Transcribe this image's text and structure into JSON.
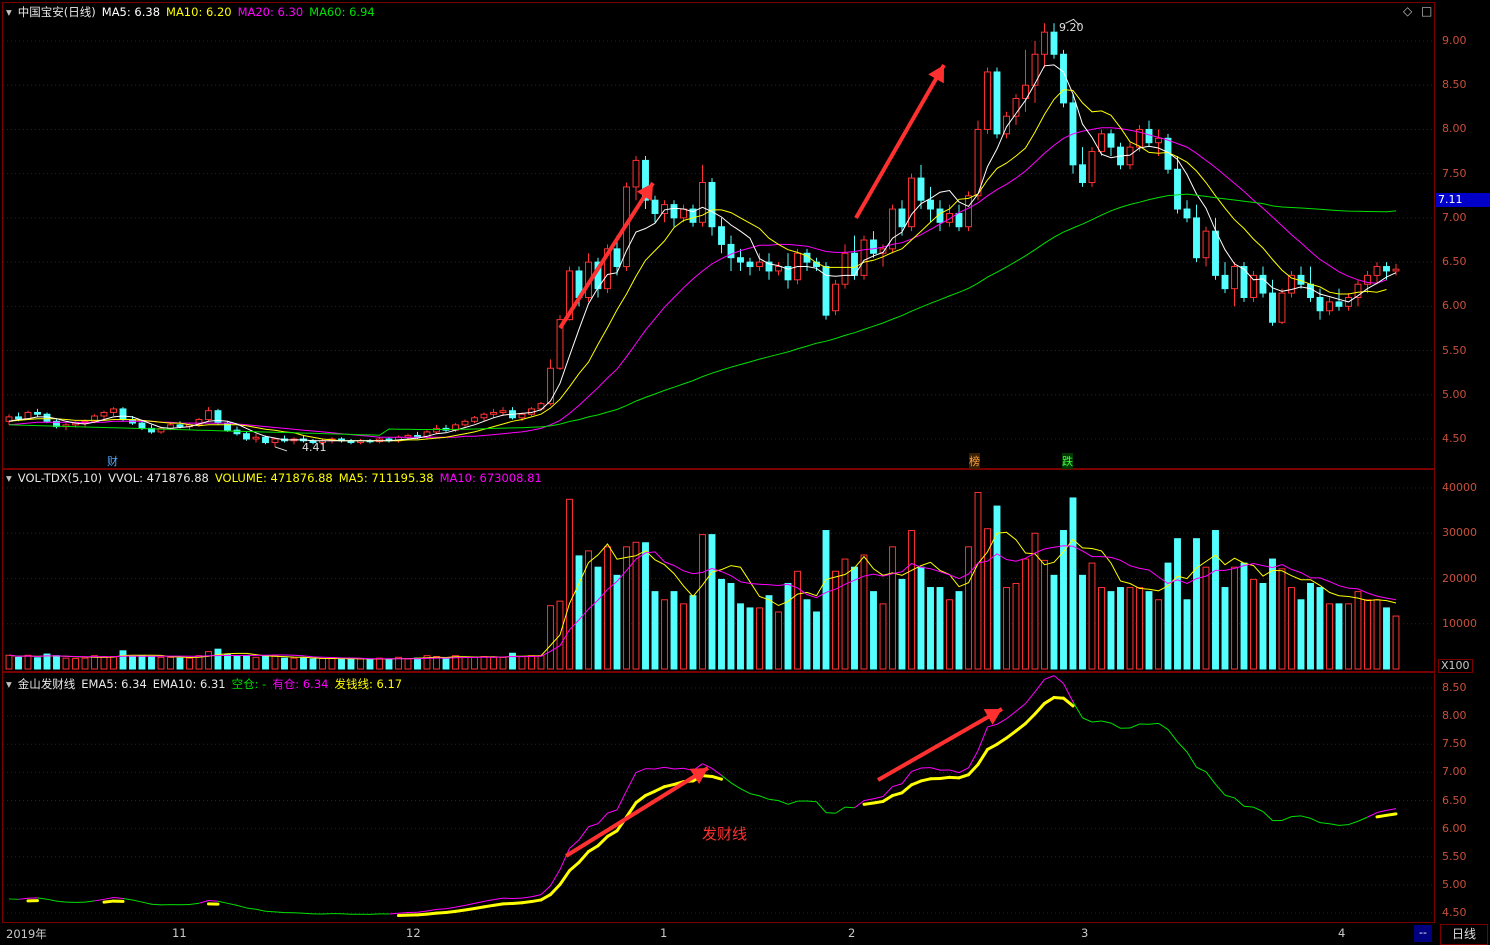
{
  "main_panel": {
    "stock_name": "中国宝安(日线)",
    "ma5": "MA5: 6.38",
    "ma10": "MA10: 6.20",
    "ma20": "MA20: 6.30",
    "ma60": "MA60: 6.94",
    "high_marker": "9.20",
    "low_marker": "4.41",
    "current_price_tag": "7.11",
    "event_tags": [
      "财",
      "榜",
      "跌"
    ],
    "y_ticks": [
      "9.00",
      "8.50",
      "8.00",
      "7.50",
      "7.00",
      "6.50",
      "6.00",
      "5.50",
      "5.00",
      "4.50"
    ]
  },
  "vol_panel": {
    "name": "VOL-TDX(5,10)",
    "vvol": "VVOL: 471876.88",
    "volume": "VOLUME: 471876.88",
    "ma5": "MA5: 711195.38",
    "ma10": "MA10: 673008.81",
    "y_ticks": [
      "40000",
      "30000",
      "20000",
      "10000"
    ],
    "unit": "X100"
  },
  "ind_panel": {
    "name": "金山发财线",
    "ema5": "EMA5: 6.34",
    "ema10": "EMA10: 6.31",
    "kongcang": "空仓: -",
    "youcang": "有仓: 6.34",
    "faqian": "发钱线: 6.17",
    "annotation": "发财线",
    "y_ticks": [
      "8.50",
      "8.00",
      "7.50",
      "7.00",
      "6.50",
      "6.00",
      "5.50",
      "5.00",
      "4.50"
    ]
  },
  "date_axis": [
    "2019年",
    "11",
    "12",
    "1",
    "2",
    "3",
    "4"
  ],
  "period_button": "日线",
  "colors": {
    "up": "#ff3232",
    "down": "#54ffff",
    "ma5": "#ffffff",
    "ma10": "#ffff00",
    "ma20": "#ff00ff",
    "ma60": "#00e000",
    "grid": "#7a0000",
    "axis_text": "#c8503c"
  },
  "chart_data": {
    "type": "candlestick",
    "title": "中国宝安(日线)",
    "price_range": [
      4.4,
      9.3
    ],
    "candles": [
      [
        4.7,
        4.78,
        4.66,
        4.75
      ],
      [
        4.75,
        4.8,
        4.7,
        4.73
      ],
      [
        4.73,
        4.82,
        4.72,
        4.8
      ],
      [
        4.8,
        4.84,
        4.75,
        4.78
      ],
      [
        4.78,
        4.8,
        4.68,
        4.7
      ],
      [
        4.7,
        4.72,
        4.62,
        4.64
      ],
      [
        4.64,
        4.68,
        4.6,
        4.66
      ],
      [
        4.66,
        4.7,
        4.63,
        4.68
      ],
      [
        4.68,
        4.72,
        4.64,
        4.7
      ],
      [
        4.7,
        4.78,
        4.68,
        4.76
      ],
      [
        4.76,
        4.82,
        4.72,
        4.8
      ],
      [
        4.8,
        4.86,
        4.76,
        4.84
      ],
      [
        4.84,
        4.86,
        4.7,
        4.72
      ],
      [
        4.72,
        4.76,
        4.66,
        4.68
      ],
      [
        4.68,
        4.7,
        4.6,
        4.62
      ],
      [
        4.62,
        4.66,
        4.56,
        4.58
      ],
      [
        4.58,
        4.64,
        4.56,
        4.62
      ],
      [
        4.62,
        4.68,
        4.6,
        4.66
      ],
      [
        4.66,
        4.7,
        4.62,
        4.64
      ],
      [
        4.64,
        4.68,
        4.6,
        4.66
      ],
      [
        4.66,
        4.74,
        4.64,
        4.72
      ],
      [
        4.72,
        4.86,
        4.7,
        4.82
      ],
      [
        4.82,
        4.84,
        4.66,
        4.68
      ],
      [
        4.68,
        4.7,
        4.58,
        4.6
      ],
      [
        4.6,
        4.64,
        4.54,
        4.56
      ],
      [
        4.56,
        4.58,
        4.48,
        4.5
      ],
      [
        4.5,
        4.56,
        4.46,
        4.52
      ],
      [
        4.52,
        4.54,
        4.44,
        4.46
      ],
      [
        4.46,
        4.52,
        4.41,
        4.5
      ],
      [
        4.5,
        4.54,
        4.46,
        4.48
      ],
      [
        4.48,
        4.52,
        4.44,
        4.5
      ],
      [
        4.5,
        4.54,
        4.46,
        4.48
      ],
      [
        4.48,
        4.5,
        4.44,
        4.46
      ],
      [
        4.46,
        4.5,
        4.43,
        4.48
      ],
      [
        4.48,
        4.52,
        4.45,
        4.5
      ],
      [
        4.5,
        4.52,
        4.46,
        4.48
      ],
      [
        4.48,
        4.5,
        4.44,
        4.46
      ],
      [
        4.46,
        4.5,
        4.44,
        4.48
      ],
      [
        4.48,
        4.5,
        4.45,
        4.47
      ],
      [
        4.47,
        4.52,
        4.45,
        4.5
      ],
      [
        4.5,
        4.52,
        4.46,
        4.48
      ],
      [
        4.48,
        4.54,
        4.46,
        4.52
      ],
      [
        4.52,
        4.56,
        4.5,
        4.54
      ],
      [
        4.54,
        4.58,
        4.5,
        4.52
      ],
      [
        4.52,
        4.6,
        4.5,
        4.58
      ],
      [
        4.58,
        4.66,
        4.56,
        4.62
      ],
      [
        4.62,
        4.66,
        4.58,
        4.6
      ],
      [
        4.6,
        4.68,
        4.58,
        4.66
      ],
      [
        4.66,
        4.72,
        4.64,
        4.7
      ],
      [
        4.7,
        4.76,
        4.68,
        4.74
      ],
      [
        4.74,
        4.8,
        4.7,
        4.78
      ],
      [
        4.78,
        4.84,
        4.74,
        4.8
      ],
      [
        4.8,
        4.86,
        4.76,
        4.82
      ],
      [
        4.82,
        4.86,
        4.72,
        4.74
      ],
      [
        4.74,
        4.8,
        4.7,
        4.78
      ],
      [
        4.78,
        4.86,
        4.76,
        4.84
      ],
      [
        4.84,
        4.92,
        4.82,
        4.9
      ],
      [
        4.9,
        5.4,
        4.88,
        5.3
      ],
      [
        5.3,
        5.9,
        5.28,
        5.85
      ],
      [
        5.85,
        6.45,
        5.84,
        6.4
      ],
      [
        6.4,
        6.45,
        6.0,
        6.1
      ],
      [
        6.1,
        6.6,
        6.05,
        6.5
      ],
      [
        6.5,
        6.55,
        6.1,
        6.2
      ],
      [
        6.2,
        6.7,
        6.15,
        6.65
      ],
      [
        6.65,
        6.8,
        6.35,
        6.45
      ],
      [
        6.45,
        7.4,
        6.4,
        7.35
      ],
      [
        7.35,
        7.7,
        7.2,
        7.65
      ],
      [
        7.65,
        7.7,
        7.1,
        7.2
      ],
      [
        7.2,
        7.25,
        6.95,
        7.05
      ],
      [
        7.05,
        7.2,
        6.95,
        7.15
      ],
      [
        7.15,
        7.2,
        6.9,
        7.0
      ],
      [
        7.0,
        7.15,
        6.95,
        7.1
      ],
      [
        7.1,
        7.15,
        6.9,
        6.95
      ],
      [
        6.95,
        7.6,
        6.9,
        7.4
      ],
      [
        7.4,
        7.45,
        6.8,
        6.9
      ],
      [
        6.9,
        7.0,
        6.6,
        6.7
      ],
      [
        6.7,
        6.8,
        6.4,
        6.55
      ],
      [
        6.55,
        6.65,
        6.4,
        6.5
      ],
      [
        6.5,
        6.55,
        6.35,
        6.45
      ],
      [
        6.45,
        6.6,
        6.4,
        6.5
      ],
      [
        6.5,
        6.6,
        6.3,
        6.4
      ],
      [
        6.4,
        6.5,
        6.35,
        6.45
      ],
      [
        6.45,
        6.6,
        6.2,
        6.3
      ],
      [
        6.3,
        6.65,
        6.25,
        6.6
      ],
      [
        6.6,
        6.65,
        6.4,
        6.5
      ],
      [
        6.5,
        6.55,
        6.4,
        6.45
      ],
      [
        6.45,
        6.5,
        5.85,
        5.9
      ],
      [
        5.95,
        6.3,
        5.9,
        6.25
      ],
      [
        6.25,
        6.7,
        6.2,
        6.6
      ],
      [
        6.6,
        6.8,
        6.3,
        6.35
      ],
      [
        6.35,
        6.8,
        6.3,
        6.75
      ],
      [
        6.75,
        6.85,
        6.55,
        6.6
      ],
      [
        6.6,
        6.7,
        6.45,
        6.65
      ],
      [
        6.65,
        7.15,
        6.6,
        7.1
      ],
      [
        7.1,
        7.2,
        6.8,
        6.9
      ],
      [
        6.9,
        7.5,
        6.85,
        7.45
      ],
      [
        7.45,
        7.6,
        7.1,
        7.2
      ],
      [
        7.2,
        7.35,
        6.95,
        7.1
      ],
      [
        7.1,
        7.2,
        6.85,
        6.95
      ],
      [
        6.95,
        7.15,
        6.9,
        7.05
      ],
      [
        7.05,
        7.15,
        6.85,
        6.9
      ],
      [
        6.9,
        7.3,
        6.85,
        7.25
      ],
      [
        7.25,
        8.1,
        7.2,
        8.0
      ],
      [
        8.0,
        8.7,
        7.95,
        8.65
      ],
      [
        8.65,
        8.7,
        7.9,
        7.95
      ],
      [
        7.95,
        8.2,
        7.9,
        8.15
      ],
      [
        8.15,
        8.4,
        8.05,
        8.35
      ],
      [
        8.35,
        8.9,
        8.2,
        8.5
      ],
      [
        8.5,
        9.0,
        8.3,
        8.85
      ],
      [
        8.85,
        9.2,
        8.7,
        9.1
      ],
      [
        9.1,
        9.2,
        8.8,
        8.85
      ],
      [
        8.85,
        8.9,
        8.25,
        8.3
      ],
      [
        8.3,
        8.4,
        7.5,
        7.6
      ],
      [
        7.6,
        7.8,
        7.35,
        7.4
      ],
      [
        7.4,
        7.8,
        7.35,
        7.75
      ],
      [
        7.75,
        8.0,
        7.7,
        7.95
      ],
      [
        7.95,
        8.0,
        7.7,
        7.8
      ],
      [
        7.8,
        7.85,
        7.55,
        7.6
      ],
      [
        7.6,
        7.85,
        7.55,
        7.8
      ],
      [
        7.8,
        8.05,
        7.75,
        8.0
      ],
      [
        8.0,
        8.1,
        7.8,
        7.85
      ],
      [
        7.85,
        8.0,
        7.7,
        7.9
      ],
      [
        7.9,
        7.95,
        7.5,
        7.55
      ],
      [
        7.55,
        7.7,
        7.05,
        7.1
      ],
      [
        7.1,
        7.2,
        6.95,
        7.0
      ],
      [
        7.0,
        7.15,
        6.5,
        6.55
      ],
      [
        6.55,
        6.9,
        6.45,
        6.85
      ],
      [
        6.85,
        7.0,
        6.3,
        6.35
      ],
      [
        6.35,
        6.5,
        6.15,
        6.2
      ],
      [
        6.2,
        6.5,
        6.0,
        6.45
      ],
      [
        6.45,
        6.5,
        6.05,
        6.1
      ],
      [
        6.1,
        6.4,
        6.05,
        6.35
      ],
      [
        6.35,
        6.45,
        6.1,
        6.15
      ],
      [
        6.15,
        6.3,
        5.78,
        5.82
      ],
      [
        5.82,
        6.2,
        5.8,
        6.15
      ],
      [
        6.15,
        6.4,
        6.1,
        6.35
      ],
      [
        6.35,
        6.45,
        6.2,
        6.25
      ],
      [
        6.25,
        6.45,
        6.05,
        6.1
      ],
      [
        6.1,
        6.2,
        5.85,
        5.95
      ],
      [
        5.95,
        6.1,
        5.9,
        6.05
      ],
      [
        6.05,
        6.2,
        5.95,
        6.0
      ],
      [
        6.0,
        6.15,
        5.95,
        6.1
      ],
      [
        6.1,
        6.3,
        6.0,
        6.25
      ],
      [
        6.25,
        6.4,
        6.15,
        6.35
      ],
      [
        6.35,
        6.5,
        6.25,
        6.45
      ],
      [
        6.45,
        6.5,
        6.3,
        6.4
      ],
      [
        6.4,
        6.48,
        6.35,
        6.42
      ]
    ],
    "ma5_series": [
      4.7,
      4.72,
      4.73,
      4.75,
      4.75,
      4.73,
      4.7,
      4.68,
      4.67,
      4.69,
      4.72,
      4.75,
      4.76,
      4.75,
      4.71,
      4.67,
      4.63,
      4.62,
      4.63,
      4.64,
      4.67,
      4.7,
      4.71,
      4.7,
      4.67,
      4.62,
      4.57,
      4.53,
      4.51,
      4.49,
      4.49,
      4.49,
      4.48,
      4.48,
      4.48,
      4.48,
      4.48,
      4.48,
      4.48,
      4.48,
      4.48,
      4.49,
      4.5,
      4.51,
      4.53,
      4.56,
      4.57,
      4.6,
      4.63,
      4.66,
      4.7,
      4.74,
      4.77,
      4.78,
      4.79,
      4.8,
      4.83,
      4.93,
      5.13,
      5.44,
      5.74,
      6.03,
      6.21,
      6.36,
      6.38,
      6.63,
      6.84,
      6.88,
      6.94,
      7.09,
      7.11,
      7.1,
      7.07,
      7.12,
      7.07,
      7.01,
      6.92,
      6.85,
      6.77,
      6.54,
      6.48,
      6.46,
      6.42,
      6.45,
      6.45,
      6.43,
      6.35,
      6.34,
      6.35,
      6.35,
      6.52,
      6.57,
      6.61,
      6.77,
      6.84,
      7.04,
      7.16,
      7.22,
      7.29,
      7.31,
      7.18,
      7.13,
      7.27,
      7.58,
      7.78,
      8.03,
      8.18,
      8.33,
      8.52,
      8.72,
      8.73,
      8.65,
      8.4,
      8.06,
      7.91,
      7.72,
      7.68,
      7.7,
      7.71,
      7.79,
      7.81,
      7.79,
      7.74,
      7.66,
      7.49,
      7.27,
      7.11,
      6.86,
      6.64,
      6.48,
      6.42,
      6.3,
      6.31,
      6.21,
      6.17,
      6.19,
      6.22,
      6.2,
      6.14,
      6.11,
      6.08,
      6.05,
      6.12,
      6.2,
      6.26,
      6.33,
      6.38
    ],
    "ma10_series": [
      4.7,
      4.71,
      4.72,
      4.73,
      4.73,
      4.73,
      4.72,
      4.71,
      4.71,
      4.71,
      4.71,
      4.72,
      4.72,
      4.72,
      4.71,
      4.7,
      4.69,
      4.68,
      4.68,
      4.66,
      4.65,
      4.66,
      4.66,
      4.66,
      4.66,
      4.65,
      4.63,
      4.61,
      4.6,
      4.58,
      4.57,
      4.54,
      4.52,
      4.5,
      4.49,
      4.48,
      4.48,
      4.48,
      4.48,
      4.48,
      4.48,
      4.48,
      4.49,
      4.49,
      4.5,
      4.51,
      4.52,
      4.54,
      4.56,
      4.58,
      4.61,
      4.64,
      4.67,
      4.7,
      4.72,
      4.75,
      4.78,
      4.85,
      4.95,
      5.09,
      5.24,
      5.37,
      5.57,
      5.76,
      5.96,
      6.14,
      6.34,
      6.52,
      6.63,
      6.74,
      6.89,
      6.97,
      7.0,
      7.03,
      7.09,
      7.09,
      7.06,
      7.0,
      6.94,
      6.88,
      6.77,
      6.7,
      6.64,
      6.61,
      6.57,
      6.49,
      6.44,
      6.44,
      6.44,
      6.44,
      6.5,
      6.52,
      6.56,
      6.61,
      6.65,
      6.75,
      6.85,
      6.95,
      7.05,
      7.1,
      7.21,
      7.22,
      7.27,
      7.43,
      7.56,
      7.62,
      7.7,
      7.79,
      7.97,
      8.17,
      8.34,
      8.45,
      8.44,
      8.3,
      8.2,
      8.21,
      8.16,
      8.02,
      7.86,
      7.81,
      7.74,
      7.73,
      7.74,
      7.69,
      7.63,
      7.53,
      7.4,
      7.25,
      7.11,
      6.98,
      6.88,
      6.76,
      6.66,
      6.53,
      6.41,
      6.32,
      6.29,
      6.25,
      6.22,
      6.16,
      6.14,
      6.14,
      6.16,
      6.17,
      6.16,
      6.19
    ],
    "ma20_series": [
      4.66,
      4.67,
      4.68,
      4.69,
      4.69,
      4.69,
      4.69,
      4.69,
      4.69,
      4.69,
      4.69,
      4.7,
      4.7,
      4.7,
      4.7,
      4.7,
      4.69,
      4.69,
      4.68,
      4.68,
      4.68,
      4.68,
      4.68,
      4.68,
      4.67,
      4.66,
      4.65,
      4.64,
      4.63,
      4.62,
      4.61,
      4.6,
      4.59,
      4.58,
      4.57,
      4.56,
      4.55,
      4.54,
      4.53,
      4.52,
      4.52,
      4.52,
      4.52,
      4.52,
      4.52,
      4.52,
      4.52,
      4.52,
      4.53,
      4.53,
      4.54,
      4.55,
      4.56,
      4.57,
      4.58,
      4.6,
      4.62,
      4.66,
      4.71,
      4.79,
      4.88,
      4.98,
      5.08,
      5.19,
      5.29,
      5.43,
      5.58,
      5.73,
      5.86,
      5.99,
      6.1,
      6.21,
      6.31,
      6.4,
      6.48,
      6.54,
      6.59,
      6.63,
      6.66,
      6.69,
      6.69,
      6.7,
      6.7,
      6.69,
      6.68,
      6.65,
      6.62,
      6.61,
      6.61,
      6.62,
      6.64,
      6.65,
      6.67,
      6.7,
      6.72,
      6.76,
      6.81,
      6.87,
      6.93,
      6.99,
      7.06,
      7.11,
      7.17,
      7.25,
      7.32,
      7.38,
      7.45,
      7.53,
      7.63,
      7.73,
      7.82,
      7.9,
      7.95,
      7.98,
      8.0,
      8.02,
      8.02,
      8.01,
      7.99,
      7.97,
      7.94,
      7.91,
      7.88,
      7.84,
      7.8,
      7.73,
      7.65,
      7.57,
      7.48,
      7.39,
      7.3,
      7.2,
      7.11,
      7.01,
      6.91,
      6.81,
      6.72,
      6.62,
      6.53,
      6.46,
      6.39,
      6.34,
      6.3,
      6.27,
      6.26,
      6.3
    ]
  }
}
